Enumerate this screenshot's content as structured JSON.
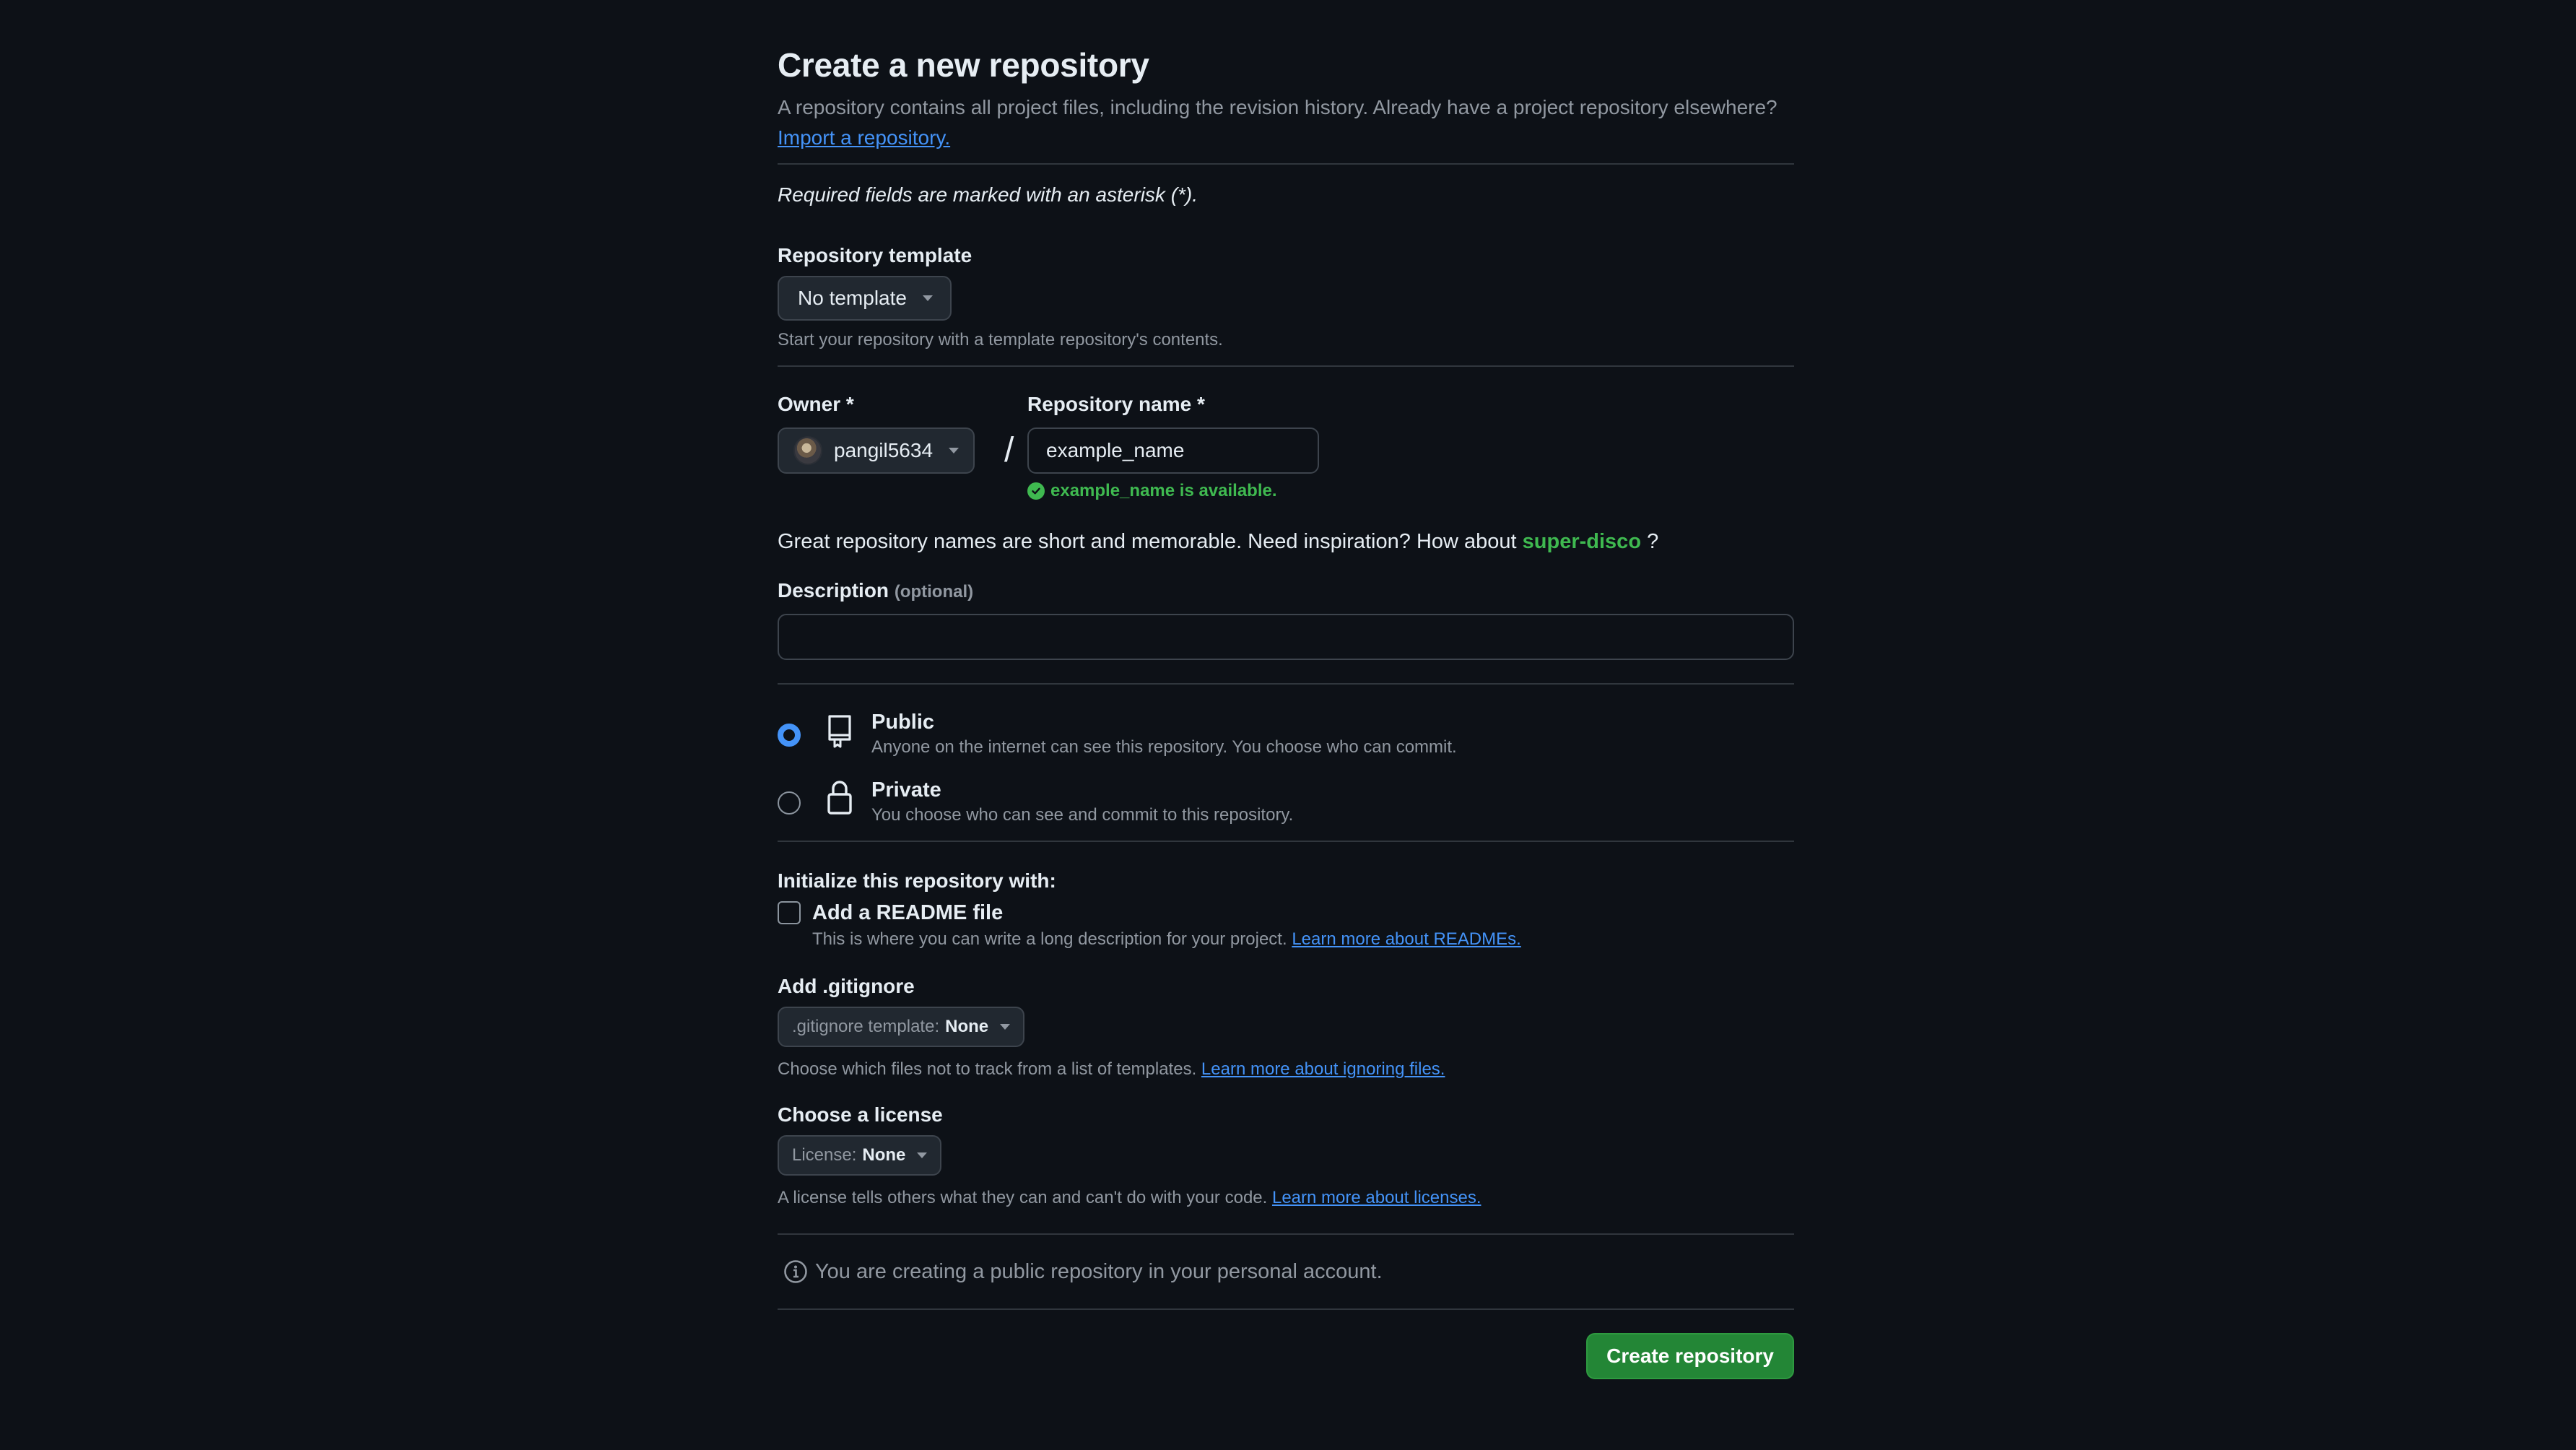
{
  "header": {
    "title": "Create a new repository",
    "subtitle_text": "A repository contains all project files, including the revision history. Already have a project repository elsewhere?",
    "import_link": "Import a repository.",
    "required_note": "Required fields are marked with an asterisk (*)."
  },
  "template": {
    "label": "Repository template",
    "selected": "No template",
    "hint": "Start your repository with a template repository's contents."
  },
  "owner": {
    "label": "Owner *",
    "selected": "pangil5634"
  },
  "separator": "/",
  "repo_name": {
    "label": "Repository name *",
    "value": "example_name",
    "availability": "example_name is available."
  },
  "inspiration": {
    "text": "Great repository names are short and memorable. Need inspiration? How about",
    "suggestion": "super-disco",
    "suffix": "?"
  },
  "description": {
    "label": "Description",
    "optional": "(optional)",
    "value": ""
  },
  "visibility": {
    "options": [
      {
        "title": "Public",
        "desc": "Anyone on the internet can see this repository. You choose who can commit.",
        "checked": true
      },
      {
        "title": "Private",
        "desc": "You choose who can see and commit to this repository.",
        "checked": false
      }
    ]
  },
  "initialize": {
    "label": "Initialize this repository with:",
    "readme_label": "Add a README file",
    "readme_checked": false,
    "readme_hint": "This is where you can write a long description for your project.",
    "readme_link": "Learn more about READMEs."
  },
  "gitignore": {
    "label": "Add .gitignore",
    "select_prefix": ".gitignore template:",
    "select_value": "None",
    "hint": "Choose which files not to track from a list of templates.",
    "link": "Learn more about ignoring files."
  },
  "license": {
    "label": "Choose a license",
    "select_prefix": "License:",
    "select_value": "None",
    "hint": "A license tells others what they can and can't do with your code.",
    "link": "Learn more about licenses."
  },
  "notice": "You are creating a public repository in your personal account.",
  "submit_label": "Create repository",
  "colors": {
    "background": "#0d1117",
    "primary_button": "#238636",
    "link": "#4493f8",
    "success": "#3fb950",
    "radio_selected": "#4493f8"
  }
}
